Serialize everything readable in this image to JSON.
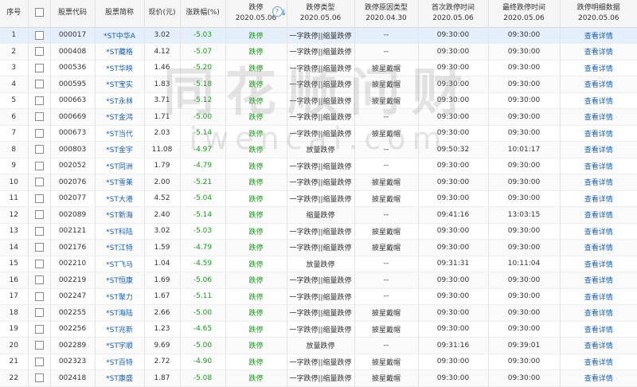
{
  "headers": {
    "seq": "序号",
    "code": "股票代码",
    "name": "股票简称",
    "price": "现价(元)",
    "change": "涨跌幅(%)",
    "limit_down": {
      "title": "跌停",
      "date": "2020.05.06"
    },
    "limit_type": {
      "title": "跌停类型",
      "date": "2020.05.06"
    },
    "reason_type": {
      "title": "跌停原因类型",
      "date": "2020.04.30"
    },
    "first_time": {
      "title": "首次跌停时间",
      "date": "2020.05.06"
    },
    "final_time": {
      "title": "最终跌停时间",
      "date": "2020.05.06"
    },
    "detail": {
      "title": "跌停明细数据",
      "date": "2020.05.06"
    }
  },
  "icons": {
    "help": "?",
    "sort": "↓"
  },
  "watermark": {
    "cn": "同花顺问财",
    "en": "iwencai.com"
  },
  "rows": [
    {
      "seq": "1",
      "code": "000017",
      "name": "*ST中华A",
      "price": "3.02",
      "change": "-5.03",
      "limit": "跌停",
      "ltype": "一字跌停||缩量跌停",
      "reason": "--",
      "first": "09:30:00",
      "final": "09:30:00",
      "detail": "查看详情"
    },
    {
      "seq": "2",
      "code": "000408",
      "name": "*ST藏格",
      "price": "4.12",
      "change": "-5.07",
      "limit": "跌停",
      "ltype": "一字跌停||缩量跌停",
      "reason": "--",
      "first": "09:30:00",
      "final": "09:30:00",
      "detail": "查看详情"
    },
    {
      "seq": "3",
      "code": "000536",
      "name": "*ST华映",
      "price": "1.46",
      "change": "-5.20",
      "limit": "跌停",
      "ltype": "一字跌停||缩量跌停",
      "reason": "披星戴帽",
      "first": "09:30:00",
      "final": "09:30:00",
      "detail": "查看详情"
    },
    {
      "seq": "4",
      "code": "000595",
      "name": "*ST宝实",
      "price": "1.83",
      "change": "-5.18",
      "limit": "跌停",
      "ltype": "一字跌停||缩量跌停",
      "reason": "披星戴帽",
      "first": "09:30:00",
      "final": "09:30:00",
      "detail": "查看详情"
    },
    {
      "seq": "5",
      "code": "000663",
      "name": "*ST永林",
      "price": "3.71",
      "change": "-5.12",
      "limit": "跌停",
      "ltype": "一字跌停||缩量跌停",
      "reason": "披星戴帽",
      "first": "09:30:00",
      "final": "09:30:00",
      "detail": "查看详情"
    },
    {
      "seq": "6",
      "code": "000669",
      "name": "*ST金鸿",
      "price": "1.71",
      "change": "-5.00",
      "limit": "跌停",
      "ltype": "一字跌停||缩量跌停",
      "reason": "--",
      "first": "09:30:00",
      "final": "09:30:00",
      "detail": "查看详情"
    },
    {
      "seq": "7",
      "code": "000673",
      "name": "*ST当代",
      "price": "2.03",
      "change": "-5.14",
      "limit": "跌停",
      "ltype": "一字跌停||缩量跌停",
      "reason": "披星戴帽",
      "first": "09:30:00",
      "final": "09:30:00",
      "detail": "查看详情"
    },
    {
      "seq": "8",
      "code": "000803",
      "name": "*ST金宇",
      "price": "11.08",
      "change": "-4.97",
      "limit": "跌停",
      "ltype": "放量跌停",
      "reason": "--",
      "first": "09:50:32",
      "final": "10:01:17",
      "detail": "查看详情"
    },
    {
      "seq": "9",
      "code": "002052",
      "name": "*ST同洲",
      "price": "1.79",
      "change": "-4.79",
      "limit": "跌停",
      "ltype": "一字跌停||缩量跌停",
      "reason": "--",
      "first": "09:30:00",
      "final": "09:30:00",
      "detail": "查看详情"
    },
    {
      "seq": "10",
      "code": "002076",
      "name": "*ST雪莱",
      "price": "2.00",
      "change": "-5.21",
      "limit": "跌停",
      "ltype": "一字跌停||缩量跌停",
      "reason": "披星戴帽",
      "first": "09:30:00",
      "final": "09:30:00",
      "detail": "查看详情"
    },
    {
      "seq": "11",
      "code": "002077",
      "name": "*ST大港",
      "price": "4.52",
      "change": "-5.04",
      "limit": "跌停",
      "ltype": "一字跌停||缩量跌停",
      "reason": "披星戴帽",
      "first": "09:30:00",
      "final": "09:30:00",
      "detail": "查看详情"
    },
    {
      "seq": "12",
      "code": "002089",
      "name": "*ST新海",
      "price": "2.40",
      "change": "-5.14",
      "limit": "跌停",
      "ltype": "缩量跌停",
      "reason": "--",
      "first": "09:41:16",
      "final": "13:03:15",
      "detail": "查看详情"
    },
    {
      "seq": "13",
      "code": "002121",
      "name": "*ST科陆",
      "price": "3.02",
      "change": "-5.03",
      "limit": "跌停",
      "ltype": "一字跌停||缩量跌停",
      "reason": "披星戴帽",
      "first": "09:30:00",
      "final": "09:30:00",
      "detail": "查看详情"
    },
    {
      "seq": "14",
      "code": "002176",
      "name": "*ST江特",
      "price": "1.59",
      "change": "-4.79",
      "limit": "跌停",
      "ltype": "一字跌停||缩量跌停",
      "reason": "披星戴帽",
      "first": "09:30:00",
      "final": "09:30:00",
      "detail": "查看详情"
    },
    {
      "seq": "15",
      "code": "002210",
      "name": "*ST飞马",
      "price": "1.04",
      "change": "-4.59",
      "limit": "跌停",
      "ltype": "放量跌停",
      "reason": "--",
      "first": "09:31:31",
      "final": "10:11:04",
      "detail": "查看详情"
    },
    {
      "seq": "16",
      "code": "002219",
      "name": "*ST恒康",
      "price": "1.69",
      "change": "-5.06",
      "limit": "跌停",
      "ltype": "一字跌停||缩量跌停",
      "reason": "--",
      "first": "09:30:00",
      "final": "09:30:00",
      "detail": "查看详情"
    },
    {
      "seq": "17",
      "code": "002247",
      "name": "*ST聚力",
      "price": "1.67",
      "change": "-5.11",
      "limit": "跌停",
      "ltype": "一字跌停||缩量跌停",
      "reason": "--",
      "first": "09:30:00",
      "final": "09:30:00",
      "detail": "查看详情"
    },
    {
      "seq": "18",
      "code": "002255",
      "name": "*ST海陆",
      "price": "2.66",
      "change": "-5.00",
      "limit": "跌停",
      "ltype": "一字跌停||缩量跌停",
      "reason": "披星戴帽",
      "first": "09:30:00",
      "final": "09:30:00",
      "detail": "查看详情"
    },
    {
      "seq": "19",
      "code": "002256",
      "name": "*ST兆新",
      "price": "1.23",
      "change": "-4.65",
      "limit": "跌停",
      "ltype": "一字跌停||缩量跌停",
      "reason": "披星戴帽",
      "first": "09:30:00",
      "final": "09:30:00",
      "detail": "查看详情"
    },
    {
      "seq": "20",
      "code": "002289",
      "name": "*ST宇顺",
      "price": "9.69",
      "change": "-5.00",
      "limit": "跌停",
      "ltype": "放量跌停",
      "reason": "--",
      "first": "09:31:16",
      "final": "09:39:01",
      "detail": "查看详情"
    },
    {
      "seq": "21",
      "code": "002323",
      "name": "*ST百特",
      "price": "2.72",
      "change": "-4.90",
      "limit": "跌停",
      "ltype": "一字跌停||缩量跌停",
      "reason": "披星戴帽",
      "first": "09:30:00",
      "final": "09:30:00",
      "detail": "查看详情"
    },
    {
      "seq": "22",
      "code": "002418",
      "name": "*ST康盛",
      "price": "1.87",
      "change": "-5.08",
      "limit": "跌停",
      "ltype": "一字跌停||缩量跌停",
      "reason": "披星戴帽",
      "first": "09:30:00",
      "final": "09:30:00",
      "detail": "查看详情"
    }
  ]
}
